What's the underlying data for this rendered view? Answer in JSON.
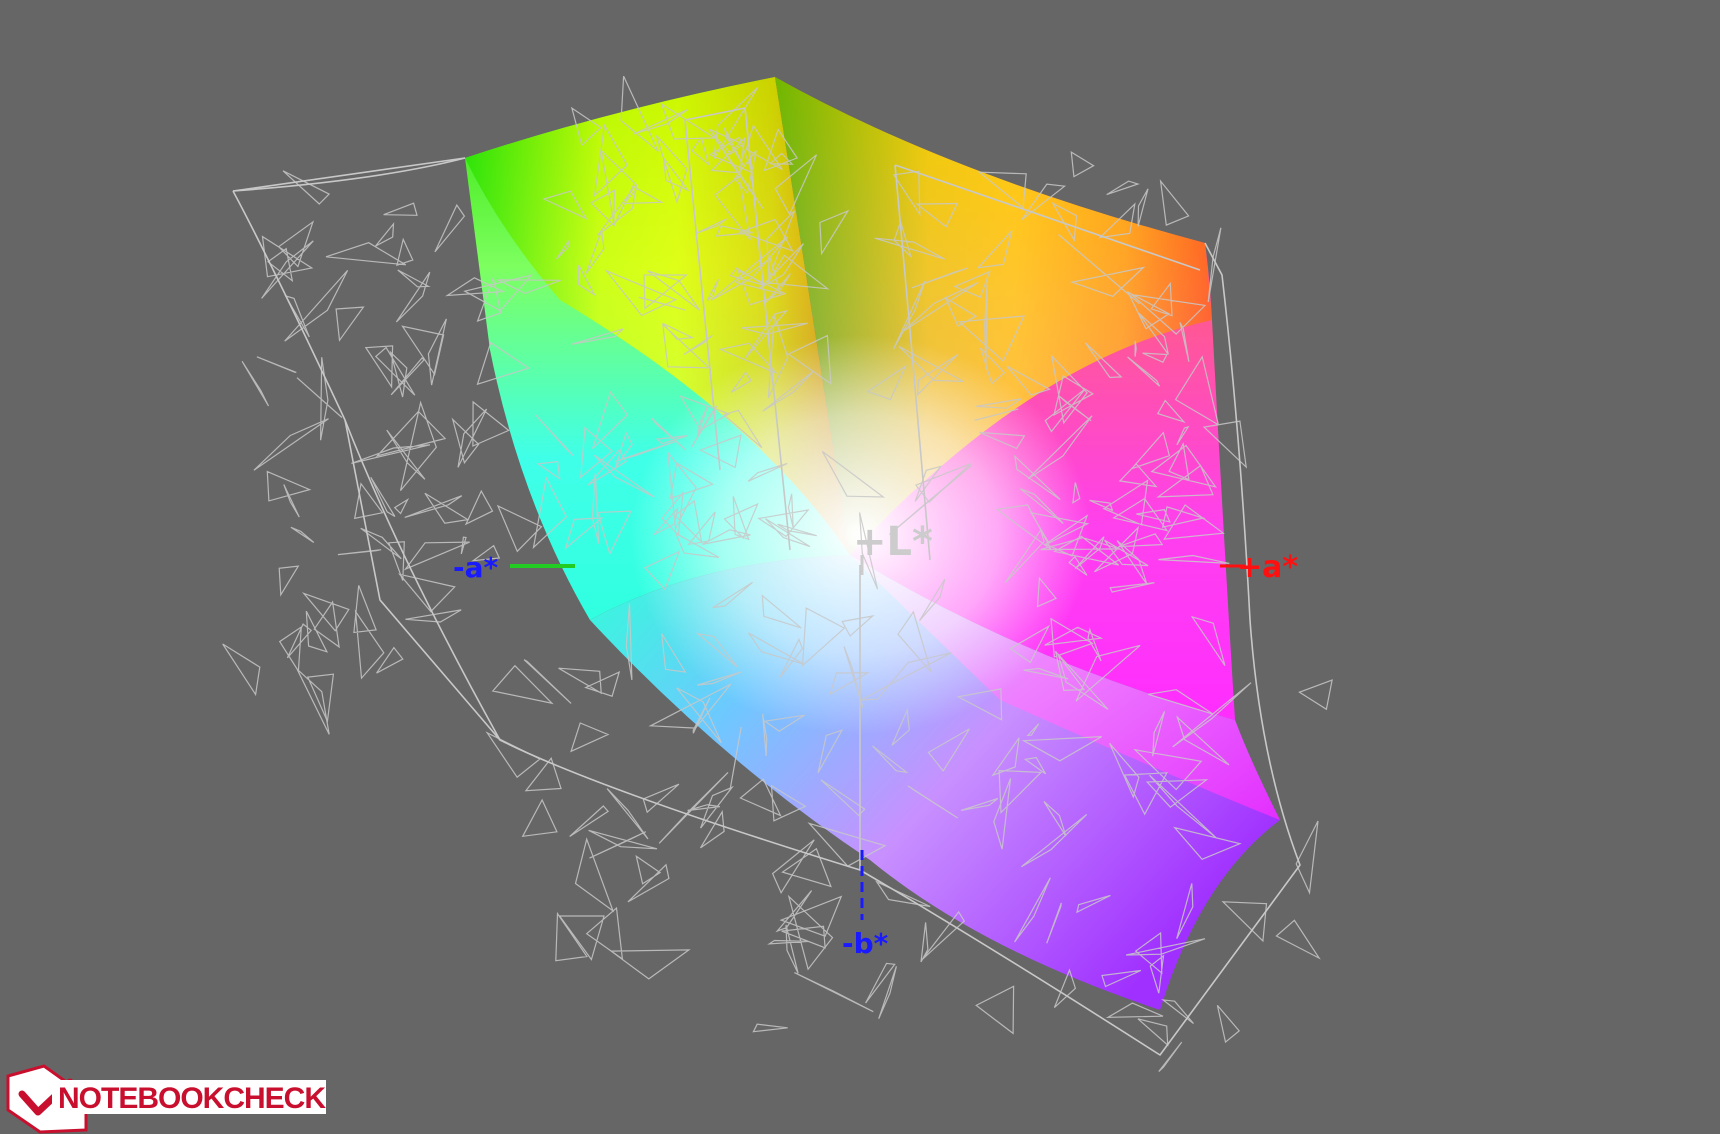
{
  "axes": {
    "plus_l": "+L*",
    "plus_a": "+a*",
    "minus_a": "-a*",
    "minus_b": "-b*"
  },
  "logo": {
    "text": "NOTEBOOKCHECK"
  },
  "colors": {
    "background": "#666666",
    "wireframe": "#c8c8c8",
    "plus_l_label": "#cccccc",
    "plus_a_label": "#ff1010",
    "minus_a_label": "#1a1aff",
    "minus_b_label": "#1a1aff",
    "minus_a_axis": "#22cc22",
    "logo_red": "#c8102e",
    "logo_white": "#ffffff"
  }
}
